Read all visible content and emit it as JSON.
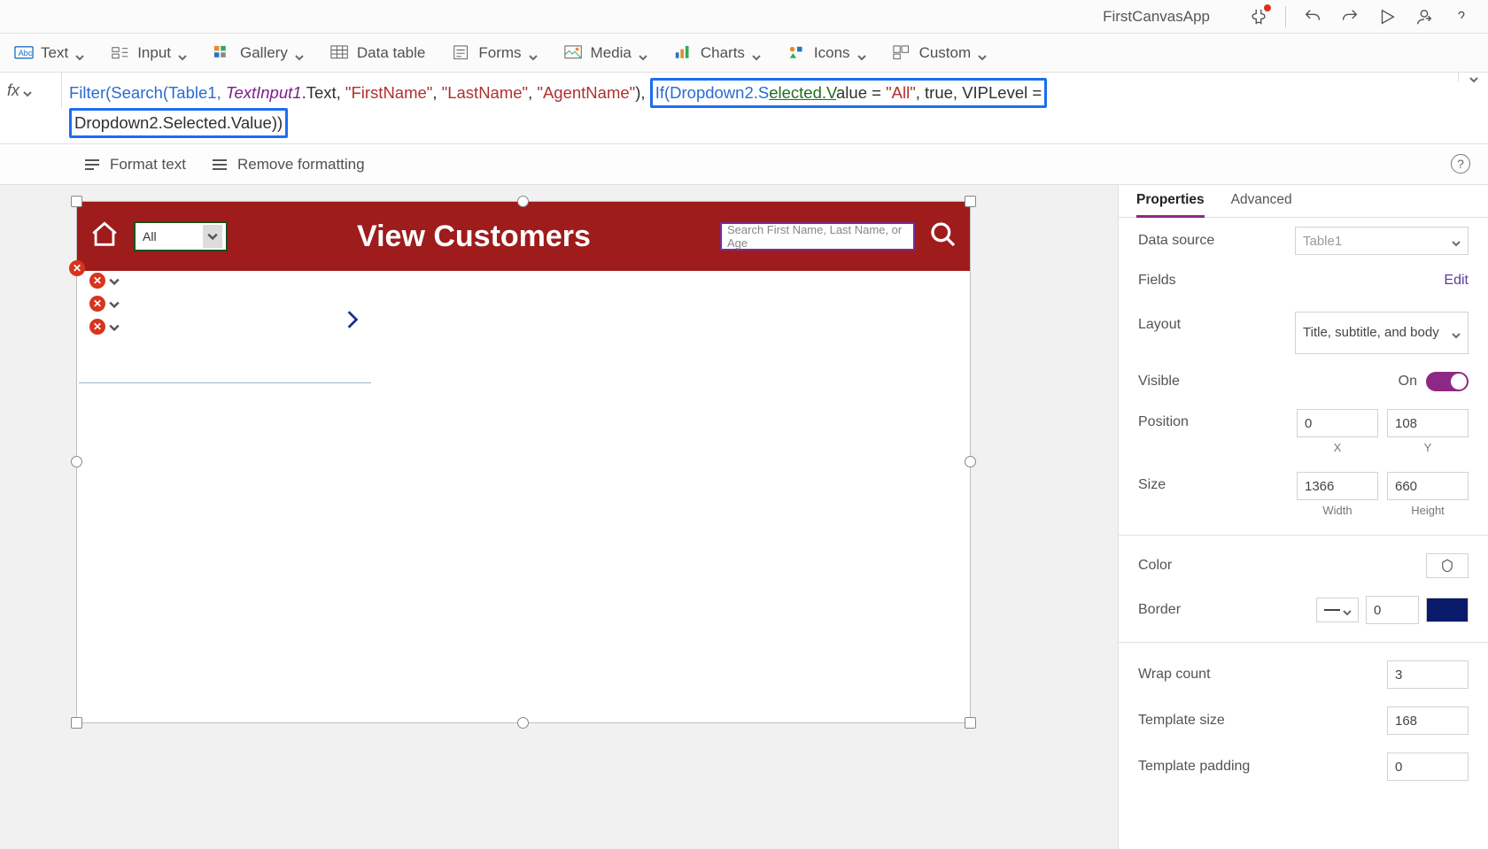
{
  "app": {
    "name": "FirstCanvasApp"
  },
  "ribbon": {
    "text": "Text",
    "input": "Input",
    "gallery": "Gallery",
    "datatable": "Data table",
    "forms": "Forms",
    "media": "Media",
    "charts": "Charts",
    "icons": "Icons",
    "custom": "Custom"
  },
  "fx": {
    "label": "fx",
    "pre": "Filter(Search(Table1, ",
    "id1": "TextInput1",
    "mid1": ".Text, ",
    "s1": "\"FirstName\"",
    "s2": "\"LastName\"",
    "s3": "\"AgentName\"",
    "hl1a": "If(Dropdown2.S",
    "hl1b": "elected.V",
    "hl1c": "alue = ",
    "hl1d": "\"All\"",
    "hl1e": ", true, VIPLevel = ",
    "hl2": "Dropdown2.Selected.Value))"
  },
  "fmt": {
    "format": "Format text",
    "remove": "Remove formatting"
  },
  "canvasApp": {
    "dropdownValue": "All",
    "title": "View Customers",
    "searchPlaceholder": "Search First Name, Last Name, or Age"
  },
  "panel": {
    "tabProps": "Properties",
    "tabAdv": "Advanced",
    "dataSource": {
      "label": "Data source",
      "value": "Table1"
    },
    "fields": {
      "label": "Fields",
      "edit": "Edit"
    },
    "layout": {
      "label": "Layout",
      "value": "Title, subtitle, and body"
    },
    "visible": {
      "label": "Visible",
      "value": "On"
    },
    "position": {
      "label": "Position",
      "x": "0",
      "y": "108",
      "xl": "X",
      "yl": "Y"
    },
    "size": {
      "label": "Size",
      "w": "1366",
      "h": "660",
      "wl": "Width",
      "hl": "Height"
    },
    "color": {
      "label": "Color"
    },
    "border": {
      "label": "Border",
      "width": "0",
      "colorHex": "#0a1a6b"
    },
    "wrap": {
      "label": "Wrap count",
      "value": "3"
    },
    "tsize": {
      "label": "Template size",
      "value": "168"
    },
    "tpad": {
      "label": "Template padding",
      "value": "0"
    }
  }
}
